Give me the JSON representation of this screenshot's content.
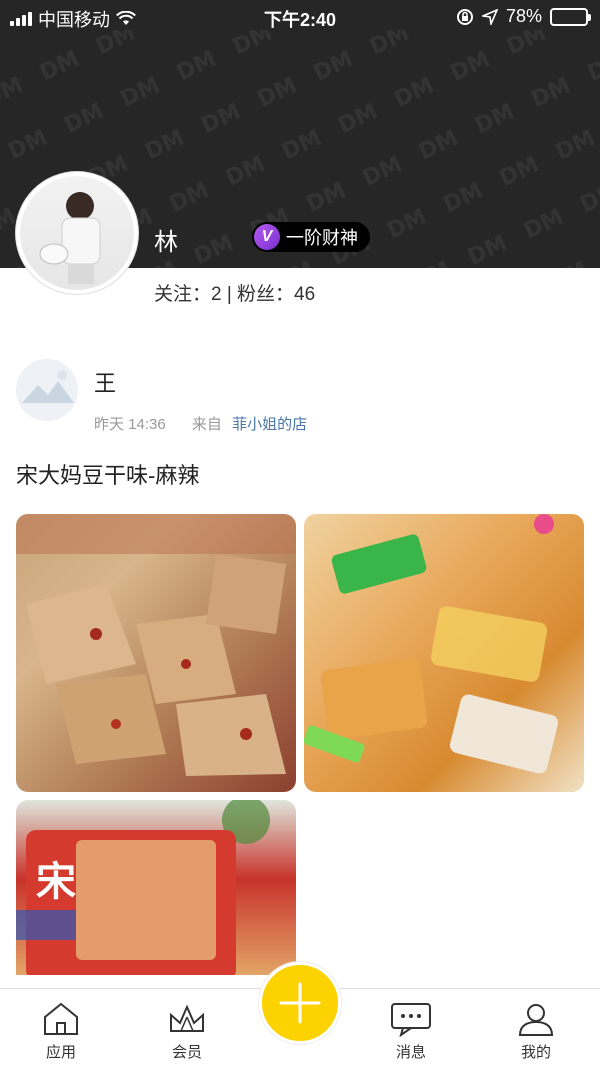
{
  "status_bar": {
    "carrier": "中国移动",
    "time": "下午2:40",
    "battery_text": "78%",
    "battery_level": 0.78
  },
  "profile": {
    "name": "林",
    "badge": "一阶财神",
    "badge_icon": "v-level-icon",
    "follow_stats": "关注：2 | 粉丝：46"
  },
  "post": {
    "author": "王",
    "time": "昨天 14:36",
    "source_prefix": "来自",
    "source_shop": "菲小姐的店",
    "title": "宋大妈豆干味-麻辣",
    "image_count": 3
  },
  "tabbar": {
    "items": [
      {
        "label": "应用",
        "icon": "home-icon"
      },
      {
        "label": "会员",
        "icon": "crown-icon"
      },
      {
        "label": "消息",
        "icon": "message-icon"
      },
      {
        "label": "我的",
        "icon": "user-icon"
      }
    ],
    "fab_icon": "plus-icon"
  },
  "colors": {
    "header_bg": "#262626",
    "accent": "#fcd200",
    "link": "#4a76a8",
    "badge_purple": "#9b45e4"
  }
}
